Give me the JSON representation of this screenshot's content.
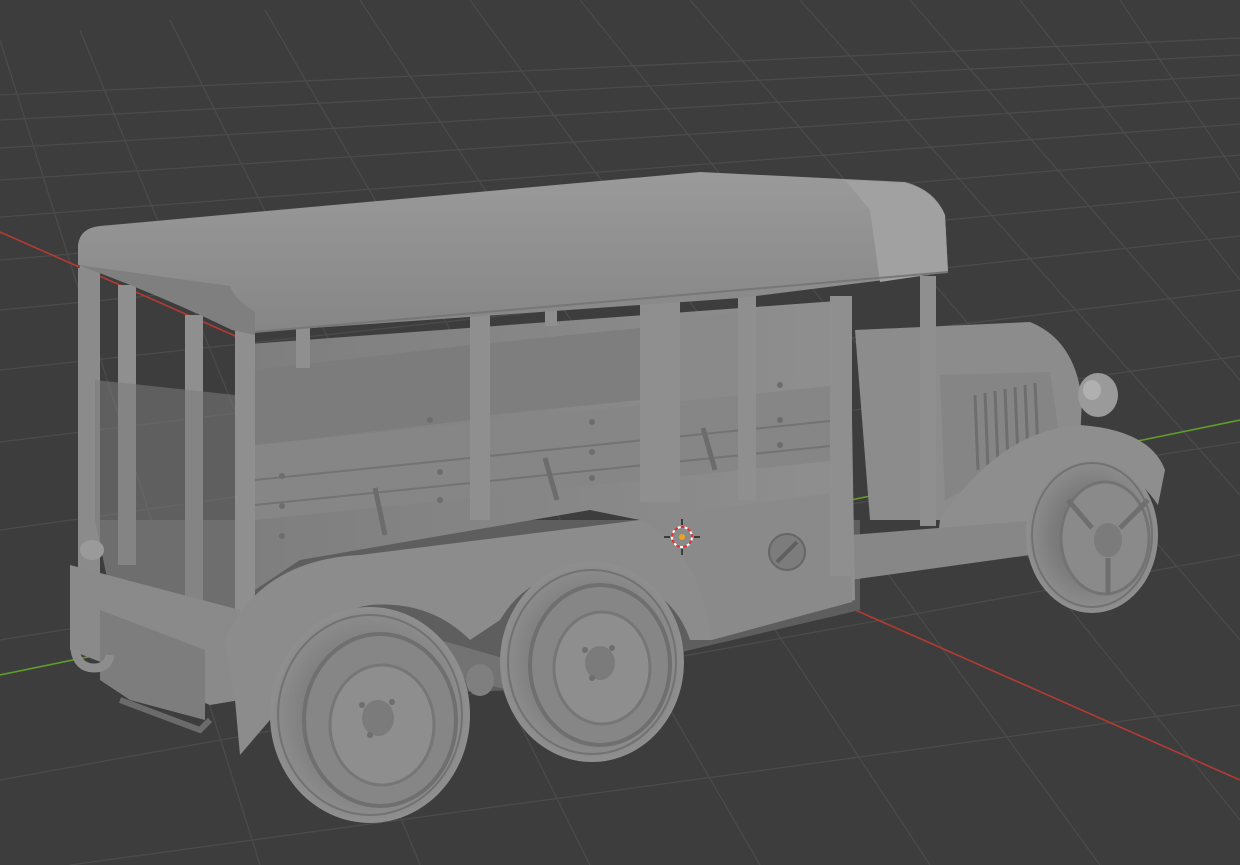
{
  "app": {
    "editor": "3D Viewport",
    "shading_mode": "solid"
  },
  "viewport": {
    "background_color": "#3d3d3d",
    "grid_line_color": "#4a4a4a",
    "x_axis_color": "#c0392b",
    "y_axis_color": "#6aa82a",
    "model_base_color": "#8e8e8e",
    "model_shadow_color": "#6b6b6b",
    "model_highlight_color": "#a8a8a8"
  },
  "scene": {
    "objects": [
      "truck-model"
    ],
    "origin_marker_icon": "3d-cursor-icon"
  }
}
